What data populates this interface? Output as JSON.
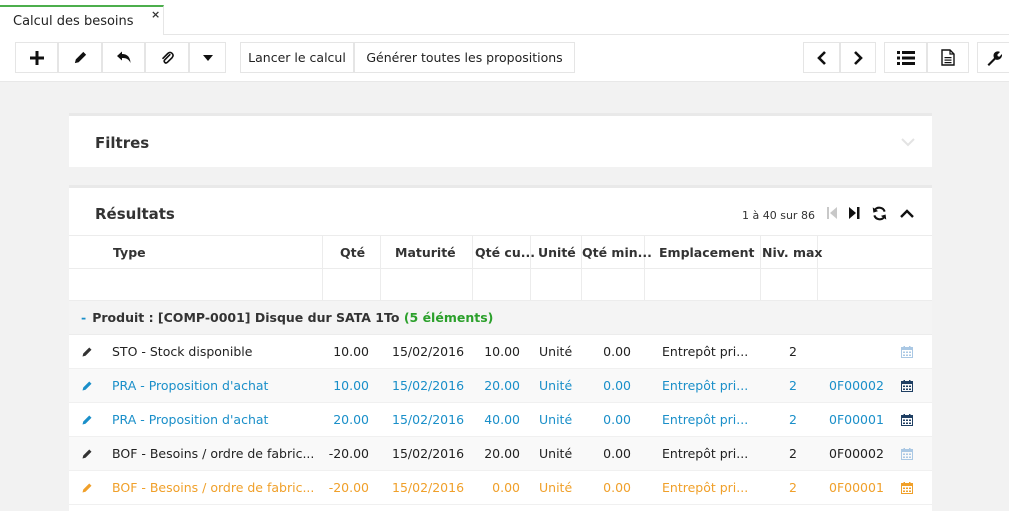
{
  "tab": {
    "title": "Calcul des besoins",
    "close": "×"
  },
  "toolbar": {
    "add_icon": "plus-icon",
    "edit_icon": "pencil-icon",
    "undo_icon": "undo-icon",
    "attach_icon": "paperclip-icon",
    "more_icon": "caret-down-icon",
    "lancer_label": "Lancer le calcul",
    "generer_label": "Générer toutes les propositions",
    "prev_icon": "chevron-left-icon",
    "next_icon": "chevron-right-icon",
    "list_icon": "list-icon",
    "doc_icon": "document-icon",
    "tools_icon": "wrench-icon"
  },
  "filters": {
    "title": "Filtres"
  },
  "results": {
    "title": "Résultats",
    "pager": "1 à 40 sur 86",
    "columns": [
      "Type",
      "Qté",
      "Maturité",
      "Qté cu...",
      "Unité",
      "Qté min...",
      "Emplacement",
      "Niv. max"
    ],
    "group": {
      "minus": "-",
      "label": "Produit : [COMP-0001] Disque dur SATA 1To",
      "count": "(5 éléments)"
    },
    "rows": [
      {
        "type": "STO - Stock disponible",
        "qte": "10.00",
        "maturite": "15/02/2016",
        "qte_cu": "10.00",
        "unite": "Unité",
        "qte_min": "0.00",
        "emplacement": "Entrepôt pri...",
        "niv_max": "2",
        "ref": ""
      },
      {
        "type": "PRA - Proposition d'achat",
        "qte": "10.00",
        "maturite": "15/02/2016",
        "qte_cu": "20.00",
        "unite": "Unité",
        "qte_min": "0.00",
        "emplacement": "Entrepôt pri...",
        "niv_max": "2",
        "ref": "0F00002"
      },
      {
        "type": "PRA - Proposition d'achat",
        "qte": "20.00",
        "maturite": "15/02/2016",
        "qte_cu": "40.00",
        "unite": "Unité",
        "qte_min": "0.00",
        "emplacement": "Entrepôt pri...",
        "niv_max": "2",
        "ref": "0F00001"
      },
      {
        "type": "BOF - Besoins / ordre de fabric...",
        "qte": "-20.00",
        "maturite": "15/02/2016",
        "qte_cu": "20.00",
        "unite": "Unité",
        "qte_min": "0.00",
        "emplacement": "Entrepôt pri...",
        "niv_max": "2",
        "ref": "0F00002"
      },
      {
        "type": "BOF - Besoins / ordre de fabric...",
        "qte": "-20.00",
        "maturite": "15/02/2016",
        "qte_cu": "0.00",
        "unite": "Unité",
        "qte_min": "0.00",
        "emplacement": "Entrepôt pri...",
        "niv_max": "2",
        "ref": "0F00001"
      }
    ]
  },
  "colors": {
    "accent": "#4cae4c",
    "blue": "#1a8fc9",
    "orange": "#f0a02a",
    "green": "#2ba02b",
    "dark": "#333333"
  }
}
